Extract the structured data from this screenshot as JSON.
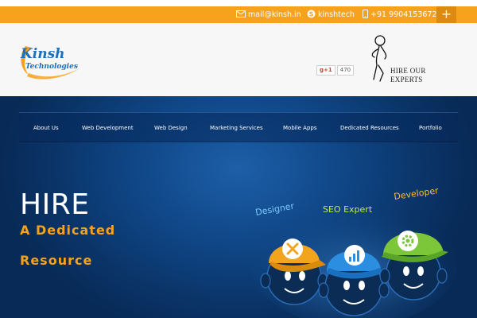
{
  "topbar": {
    "email": "mail@kinsh.in",
    "skype": "kinshtech",
    "phone": "+91 9904153672",
    "plus_label": "+",
    "color": "#f6a21d"
  },
  "header": {
    "logo_main": "Kinsh",
    "logo_sub": "Technologies",
    "gplus_label": "g+1",
    "gplus_count": "470",
    "hire_line1": "HIRE OUR",
    "hire_line2": "EXPERTS"
  },
  "nav": {
    "items": [
      {
        "label": "About Us"
      },
      {
        "label": "Web Development"
      },
      {
        "label": "Web Design"
      },
      {
        "label": "Marketing Services"
      },
      {
        "label": "Mobile Apps"
      },
      {
        "label": "Dedicated Resources"
      },
      {
        "label": "Portfolio"
      }
    ]
  },
  "hero": {
    "title": "HIRE",
    "subtitle_line1": "A Dedicated",
    "subtitle_line2": "Resource",
    "labels": {
      "designer": "Designer",
      "seo": "SEO Expert",
      "developer": "Developer"
    },
    "accent": "#f6a21d",
    "background": "#0f4686"
  }
}
